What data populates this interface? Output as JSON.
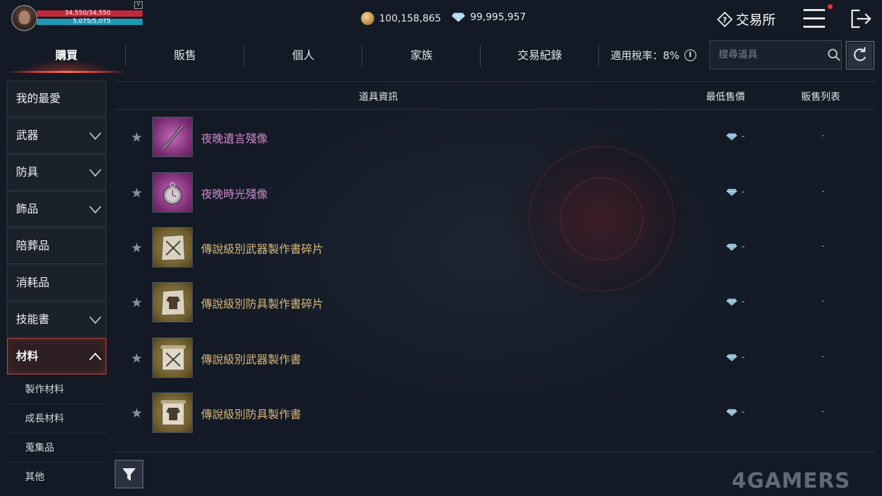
{
  "player": {
    "hp": "34,550/34,550",
    "mp": "5,075/5,075",
    "badge": "Y"
  },
  "currency": {
    "gold": "100,158,865",
    "diamond": "99,995,957"
  },
  "header": {
    "title": "交易所"
  },
  "tabs": [
    {
      "label": "購買",
      "active": true
    },
    {
      "label": "販售",
      "active": false
    },
    {
      "label": "個人",
      "active": false
    },
    {
      "label": "家族",
      "active": false
    },
    {
      "label": "交易紀錄",
      "active": false
    }
  ],
  "tax": {
    "label": "適用稅率：8%",
    "info_icon": "i"
  },
  "search": {
    "placeholder": "搜尋道具"
  },
  "sidebar": {
    "categories": [
      {
        "label": "我的最愛",
        "expandable": false
      },
      {
        "label": "武器",
        "expandable": true
      },
      {
        "label": "防具",
        "expandable": true
      },
      {
        "label": "飾品",
        "expandable": true
      },
      {
        "label": "陪葬品",
        "expandable": false
      },
      {
        "label": "消耗品",
        "expandable": false
      },
      {
        "label": "技能書",
        "expandable": true
      },
      {
        "label": "材料",
        "expandable": true,
        "expanded": true
      }
    ],
    "subcategories": [
      "製作材料",
      "成長材料",
      "蒐集品",
      "其他"
    ]
  },
  "table": {
    "headers": {
      "item_info": "道具資訊",
      "lowest_price": "最低售價",
      "listings": "販售列表"
    },
    "rows": [
      {
        "name": "夜晚遺言殘像",
        "grade": "purple",
        "icon": "sword-icon",
        "price": "-",
        "listings": "-"
      },
      {
        "name": "夜晚時光殘像",
        "grade": "purple",
        "icon": "pocket-watch-icon",
        "price": "-",
        "listings": "-"
      },
      {
        "name": "傳說級別武器製作書碎片",
        "grade": "gold",
        "icon": "weapon-scroll-fragment-icon",
        "price": "-",
        "listings": "-"
      },
      {
        "name": "傳說級別防具製作書碎片",
        "grade": "gold",
        "icon": "armor-scroll-fragment-icon",
        "price": "-",
        "listings": "-"
      },
      {
        "name": "傳說級別武器製作書",
        "grade": "gold",
        "icon": "weapon-scroll-icon",
        "price": "-",
        "listings": "-"
      },
      {
        "name": "傳說級別防具製作書",
        "grade": "gold",
        "icon": "armor-scroll-icon",
        "price": "-",
        "listings": "-"
      }
    ]
  },
  "watermark": "4GAMERS",
  "colors": {
    "accent_red": "#e04038",
    "hp": "#c3283a",
    "mp": "#1e98b5",
    "purple_grade": "#d08ac8",
    "gold_grade": "#d9b67a"
  }
}
